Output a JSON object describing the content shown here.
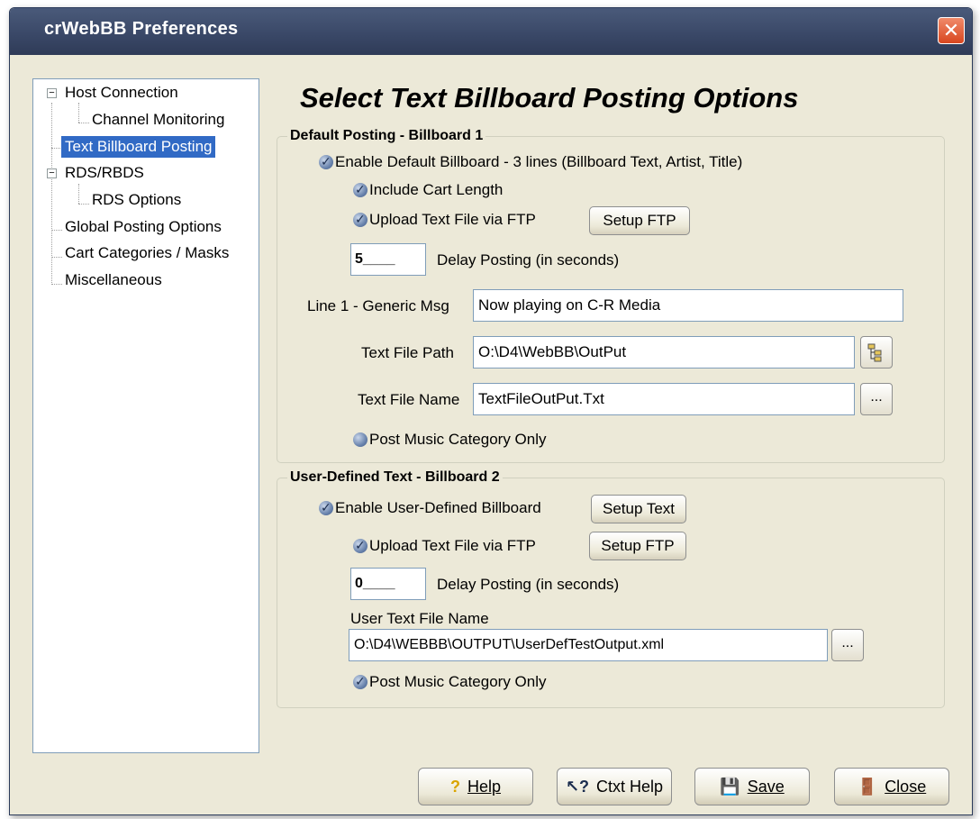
{
  "window": {
    "title": "crWebBB Preferences",
    "close_glyph": "✕"
  },
  "tree": {
    "items": [
      {
        "label": "Host Connection",
        "expander": "−"
      },
      {
        "label": "Channel Monitoring"
      },
      {
        "label": "Text Billboard Posting",
        "selected": true
      },
      {
        "label": "RDS/RBDS",
        "expander": "−"
      },
      {
        "label": "RDS Options"
      },
      {
        "label": "Global Posting Options"
      },
      {
        "label": "Cart Categories / Masks"
      },
      {
        "label": "Miscellaneous"
      }
    ]
  },
  "main": {
    "heading": "Select Text Billboard Posting Options",
    "default_group": {
      "label": "Default Posting - Billboard 1",
      "enable_default": "Enable Default Billboard - 3 lines (Billboard Text, Artist, Title)",
      "include_cart_length": "Include Cart Length",
      "upload_ftp": "Upload Text File via FTP",
      "setup_ftp": "Setup FTP",
      "delay_value": "5____",
      "delay_label": "Delay Posting (in seconds)",
      "line1_label": "Line 1 - Generic Msg",
      "line1_value": "Now playing on C-R Media",
      "path_label": "Text File Path",
      "path_value": "O:\\D4\\WebBB\\OutPut",
      "name_label": "Text File Name",
      "name_value": "TextFileOutPut.Txt",
      "browse_glyph": "...",
      "post_music": "Post Music Category Only"
    },
    "user_group": {
      "label": "User-Defined Text - Billboard 2",
      "enable_user": "Enable User-Defined Billboard",
      "setup_text": "Setup Text",
      "upload_ftp": "Upload Text File via FTP",
      "setup_ftp": "Setup FTP",
      "delay_value": "0____",
      "delay_label": "Delay Posting (in seconds)",
      "file_label": "User Text File Name",
      "file_value": "O:\\D4\\WEBBB\\OUTPUT\\UserDefTestOutput.xml",
      "browse_glyph": "...",
      "post_music": "Post Music Category Only"
    }
  },
  "footer": {
    "help": {
      "label": "Help",
      "icon": "?"
    },
    "ctxt_help": {
      "label": "Ctxt Help",
      "icon": "↖?"
    },
    "save": {
      "label": "Save",
      "icon": "💾"
    },
    "close": {
      "label": "Close",
      "icon": "🚪"
    }
  },
  "colors": {
    "selection": "#316ac5",
    "dialog_bg": "#ece9d8",
    "title_bar": "#394766",
    "close_red": "#d8461f"
  }
}
